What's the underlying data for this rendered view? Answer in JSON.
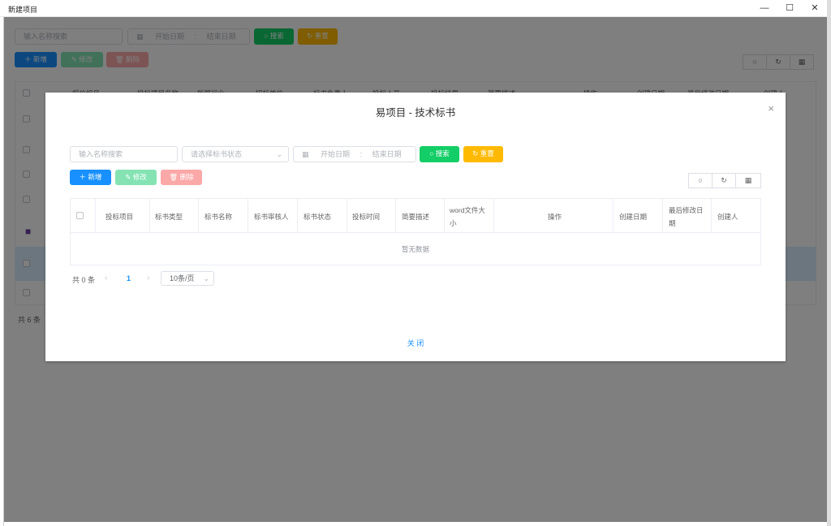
{
  "window": {
    "title": "新建项目",
    "minimize": "—",
    "maximize": "☐",
    "close": "✕"
  },
  "background": {
    "search_placeholder": "输入名称搜索",
    "start_date": "开始日期",
    "date_sep": ":",
    "end_date": "结束日期",
    "search_btn": "搜索",
    "reset_btn": "重置",
    "add_btn": "新增",
    "edit_btn": "修改",
    "delete_btn": "删除",
    "columns": [
      "报价编号",
      "投标项目名称",
      "所属行业",
      "招标单位",
      "标书负责人",
      "投标人员",
      "投标结果",
      "简要描述",
      "操作",
      "创建日期",
      "最后修改日期",
      "创建人"
    ],
    "total": "共 6 条"
  },
  "modal": {
    "title": "易项目 - 技术标书",
    "close_icon": "×",
    "search_placeholder": "输入名称搜索",
    "status_placeholder": "请选择标书状态",
    "start_date": "开始日期",
    "date_sep": ":",
    "end_date": "结束日期",
    "search_btn": "搜索",
    "reset_btn": "重置",
    "add_btn": "新增",
    "edit_btn": "修改",
    "delete_btn": "删除",
    "columns": [
      "投标项目",
      "标书类型",
      "标书名称",
      "标书审核人",
      "标书状态",
      "投标时间",
      "简要描述",
      "word文件大小",
      "操作",
      "创建日期",
      "最后修改日期",
      "创建人"
    ],
    "empty_text": "暂无数据",
    "total": "共 0 条",
    "current_page": "1",
    "page_size": "10条/页",
    "footer_close": "关 闭"
  }
}
